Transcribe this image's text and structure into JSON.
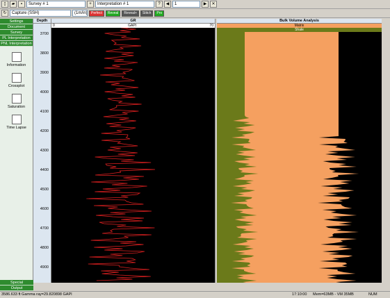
{
  "toolbar1": {
    "survey": "Survey # 1",
    "interp": "Interpretation # 1",
    "page": "1"
  },
  "toolbar2": {
    "tool": "Capture (SSH)",
    "zoom": "(1m/in)",
    "b1": "Perfect",
    "b2": "Reveal",
    "b3": "Reveal+",
    "b4": "Stitch",
    "b5": "Pro"
  },
  "sidebar": {
    "items": [
      "Settings",
      "Document",
      "Survey",
      "PL Interpretation",
      "PNL Interpretation"
    ],
    "tools": [
      "Information",
      "Crossplot",
      "Saturation",
      "Time Lapse"
    ],
    "bottom": [
      "Special",
      "Output"
    ]
  },
  "depth": {
    "header": "Depth",
    "ticks": [
      "3700",
      "3800",
      "3900",
      "4000",
      "4100",
      "4200",
      "4300",
      "4400",
      "4500",
      "4600",
      "4700",
      "4800",
      "4900"
    ]
  },
  "gr": {
    "header": "GR",
    "unit": "GAPI",
    "min": "0",
    "max": "70"
  },
  "bva": {
    "header": "Bulk Volume Analysis",
    "leg1": "Matrix",
    "leg2": "Shale"
  },
  "status": {
    "left": "3586.633 ft  Gamma ray=29.820898 GAPI",
    "time": "17:10:00",
    "mem": "Mem=63MB - VM 35MB",
    "num": "NUM"
  }
}
